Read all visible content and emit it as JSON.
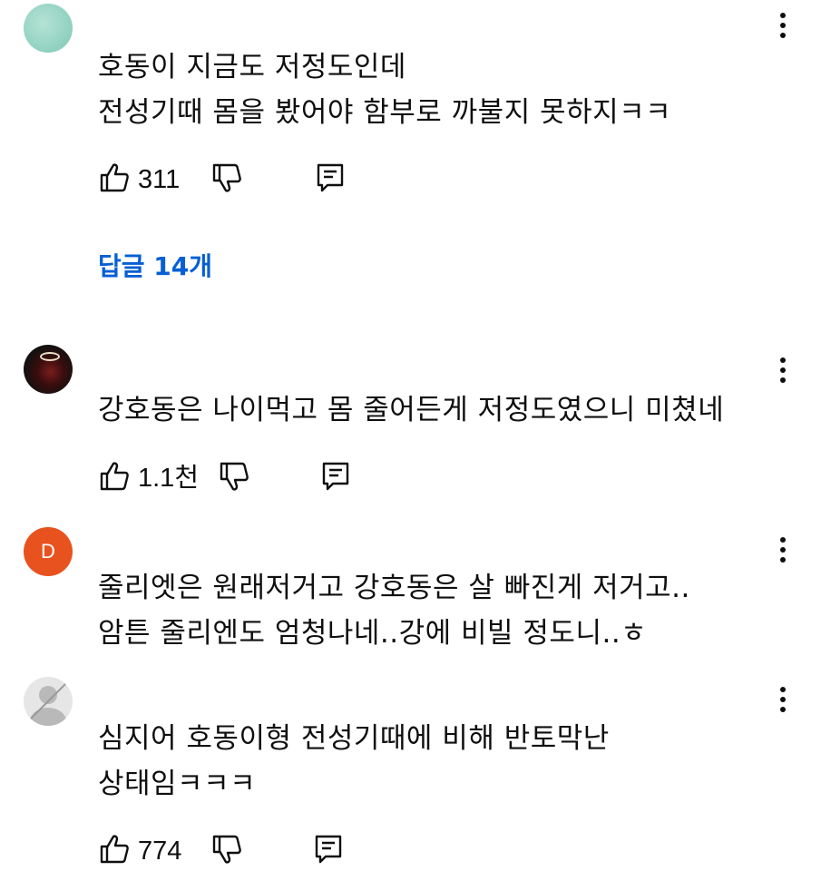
{
  "comments": [
    {
      "lines": [
        "호동이 지금도 저정도인데",
        "전성기때 몸을 봤어야 함부로 까불지 못하지ㅋㅋ"
      ],
      "likes": "311",
      "replies_label": "답글 14개",
      "avatar": "teal-texture-avatar"
    },
    {
      "lines": [
        "강호동은 나이먹고 몸 줄어든게 저정도였으니 미쳤네"
      ],
      "likes": "1.1천",
      "avatar": "dark-photo-avatar"
    },
    {
      "lines": [
        "줄리엣은 원래저거고 강호동은 살 빠진게 저거고..",
        "암튼 줄리엔도 엄청나네..강에 비빌 정도니..ㅎ"
      ],
      "avatar": "letter-avatar",
      "avatar_letter": "D",
      "avatar_color": "#e8521f"
    },
    {
      "lines": [
        "심지어 호동이형 전성기때에 비해 반토막난",
        "상태임ㅋㅋㅋ"
      ],
      "likes": "774",
      "avatar": "default-user-avatar"
    }
  ],
  "colors": {
    "reply_link": "#065fd4",
    "text": "#0f0f0f",
    "background": "#ffffff"
  },
  "icons": [
    "like-icon",
    "dislike-icon",
    "reply-icon",
    "more-options-icon"
  ]
}
